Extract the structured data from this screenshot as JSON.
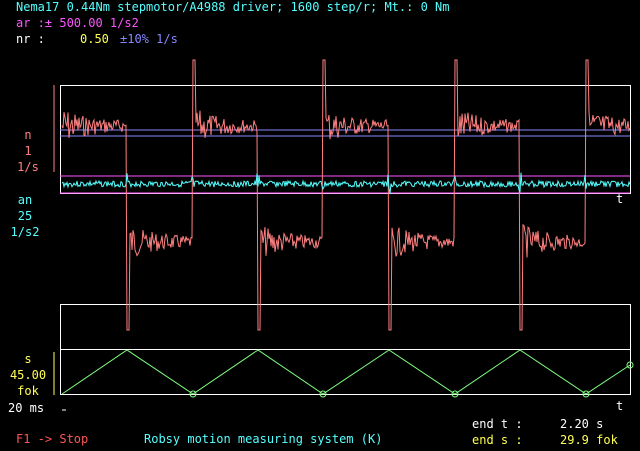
{
  "header": {
    "line1": "Nema17 0.44Nm stepmotor/A4988 driver; 1600 step/r; Mt.: 0 Nm",
    "line2": "ar :± 500.00 1/s2",
    "line3_label": "nr :",
    "line3_value": "0.50",
    "line3_tol": "±10% 1/s"
  },
  "axis_labels": {
    "n": "n",
    "n_val": "1",
    "n_unit": "1/s",
    "an": "an",
    "an_val": "25",
    "an_unit": "1/s2",
    "s": "s",
    "s_val": "45.00",
    "s_unit": "fok",
    "time": "20 ms",
    "t_mark": "t"
  },
  "footer": {
    "stop": "F1 -> Stop",
    "system": "Robsy motion measuring system (K)",
    "end_t_label": "end t :",
    "end_t_value": "2.20 s",
    "end_s_label": "end s :",
    "end_s_value": "29.9 fok"
  },
  "colors": {
    "velocity": "#ff8080",
    "accel": "#55ffff",
    "position": "#7fff7f",
    "frame": "#ffffff",
    "ref": "#8888ff",
    "limit": "#ff55ff"
  },
  "chart_data": {
    "type": "line",
    "series": [
      {
        "name": "n",
        "description_key": "velocity"
      },
      {
        "name": "an",
        "description_key": "acceleration"
      },
      {
        "name": "s",
        "description_key": "position"
      }
    ],
    "position_peaks_fok": 45.0,
    "cycles": 4.5
  }
}
